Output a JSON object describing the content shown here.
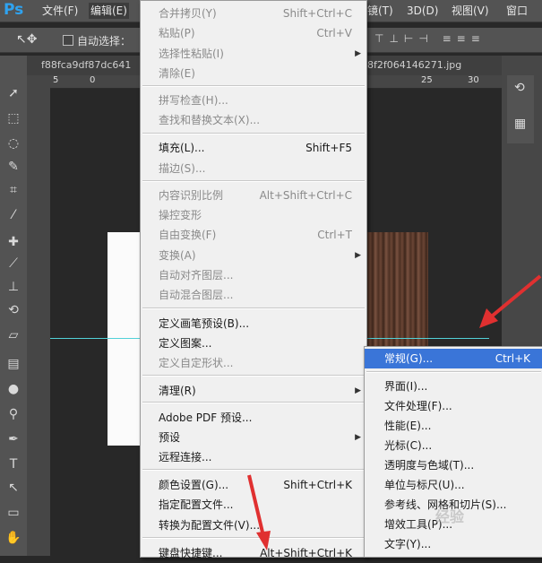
{
  "app": {
    "logo": "Ps"
  },
  "menubar": {
    "items": [
      {
        "label": "文件(F)"
      },
      {
        "label": "编辑(E)"
      },
      {
        "label": "镜(T)"
      },
      {
        "label": "3D(D)"
      },
      {
        "label": "视图(V)"
      },
      {
        "label": "窗口"
      }
    ]
  },
  "options": {
    "auto_select_label": "自动选择："
  },
  "tabs": {
    "left": "f88fca9df87dc641",
    "right": "8f2f064146271.jpg"
  },
  "ruler": {
    "ticks": [
      "5",
      "0",
      "25",
      "30"
    ]
  },
  "edit_menu": {
    "items": [
      {
        "label": "合并拷贝(Y)",
        "shortcut": "Shift+Ctrl+C",
        "disabled": true
      },
      {
        "label": "粘贴(P)",
        "shortcut": "Ctrl+V",
        "disabled": true
      },
      {
        "label": "选择性粘贴(I)",
        "submenu": true,
        "disabled": true
      },
      {
        "label": "清除(E)",
        "disabled": true
      },
      {
        "label": "拼写检查(H)...",
        "disabled": true
      },
      {
        "label": "查找和替换文本(X)...",
        "disabled": true
      },
      {
        "label": "填充(L)...",
        "shortcut": "Shift+F5",
        "disabled": false
      },
      {
        "label": "描边(S)...",
        "disabled": true
      },
      {
        "label": "内容识别比例",
        "shortcut": "Alt+Shift+Ctrl+C",
        "disabled": true
      },
      {
        "label": "操控变形",
        "disabled": true
      },
      {
        "label": "自由变换(F)",
        "shortcut": "Ctrl+T",
        "disabled": true
      },
      {
        "label": "变换(A)",
        "submenu": true,
        "disabled": true
      },
      {
        "label": "自动对齐图层...",
        "disabled": true
      },
      {
        "label": "自动混合图层...",
        "disabled": true
      },
      {
        "label": "定义画笔预设(B)...",
        "disabled": false
      },
      {
        "label": "定义图案...",
        "disabled": false
      },
      {
        "label": "定义自定形状...",
        "disabled": true
      },
      {
        "label": "清理(R)",
        "submenu": true,
        "disabled": false
      },
      {
        "label": "Adobe PDF 预设...",
        "disabled": false
      },
      {
        "label": "预设",
        "submenu": true,
        "disabled": false
      },
      {
        "label": "远程连接...",
        "disabled": false
      },
      {
        "label": "颜色设置(G)...",
        "shortcut": "Shift+Ctrl+K",
        "disabled": false
      },
      {
        "label": "指定配置文件...",
        "disabled": false
      },
      {
        "label": "转换为配置文件(V)...",
        "disabled": false
      },
      {
        "label": "键盘快捷键...",
        "shortcut": "Alt+Shift+Ctrl+K",
        "disabled": false
      }
    ]
  },
  "pref_menu": {
    "items": [
      {
        "label": "常规(G)...",
        "shortcut": "Ctrl+K",
        "highlighted": true
      },
      {
        "label": "界面(I)..."
      },
      {
        "label": "文件处理(F)..."
      },
      {
        "label": "性能(E)..."
      },
      {
        "label": "光标(C)..."
      },
      {
        "label": "透明度与色域(T)..."
      },
      {
        "label": "单位与标尺(U)..."
      },
      {
        "label": "参考线、网格和切片(S)..."
      },
      {
        "label": "增效工具(P)..."
      },
      {
        "label": "文字(Y)..."
      }
    ]
  },
  "watermark": "经验",
  "colors": {
    "highlight": "#3a75d8",
    "guide": "#52d1d8",
    "annotation_arrow": "#e03030"
  }
}
